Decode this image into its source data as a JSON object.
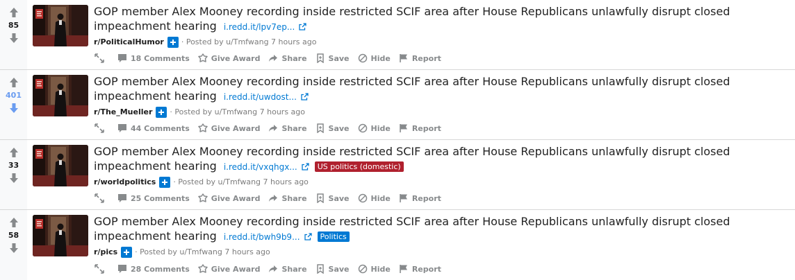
{
  "posts": [
    {
      "score": "85",
      "upvoted": false,
      "title": "GOP member Alex Mooney recording inside restricted SCIF area after House Republicans unlawfully disrupt closed impeachment hearing",
      "domain": "i.redd.it/lpv7ep...",
      "flair": null,
      "subreddit": "r/PoliticalHumor",
      "posted": "· Posted by u/Tmfwang 7 hours ago",
      "comments": "18 Comments"
    },
    {
      "score": "401",
      "upvoted": true,
      "title": "GOP member Alex Mooney recording inside restricted SCIF area after House Republicans unlawfully disrupt closed impeachment hearing",
      "domain": "i.redd.it/uwdost...",
      "flair": null,
      "subreddit": "r/The_Mueller",
      "posted": "· Posted by u/Tmfwang 7 hours ago",
      "comments": "44 Comments"
    },
    {
      "score": "33",
      "upvoted": false,
      "title": "GOP member Alex Mooney recording inside restricted SCIF area after House Republicans unlawfully disrupt closed impeachment hearing",
      "domain": "i.redd.it/vxqhgx...",
      "flair": {
        "text": "US politics (domestic)",
        "color": "#b0202e"
      },
      "subreddit": "r/worldpolitics",
      "posted": "· Posted by u/Tmfwang 7 hours ago",
      "comments": "25 Comments"
    },
    {
      "score": "58",
      "upvoted": false,
      "title": "GOP member Alex Mooney recording inside restricted SCIF area after House Republicans unlawfully disrupt closed impeachment hearing",
      "domain": "i.redd.it/bwh9b9...",
      "flair": {
        "text": "Politics",
        "color": "#0079d3"
      },
      "subreddit": "r/pics",
      "posted": "· Posted by u/Tmfwang 7 hours ago",
      "comments": "28 Comments"
    }
  ],
  "actions": {
    "award": "Give Award",
    "share": "Share",
    "save": "Save",
    "hide": "Hide",
    "report": "Report"
  },
  "colors": {
    "accent": "#0079d3",
    "upvoted_score": "#6a9cf0",
    "muted": "#878a8c"
  }
}
